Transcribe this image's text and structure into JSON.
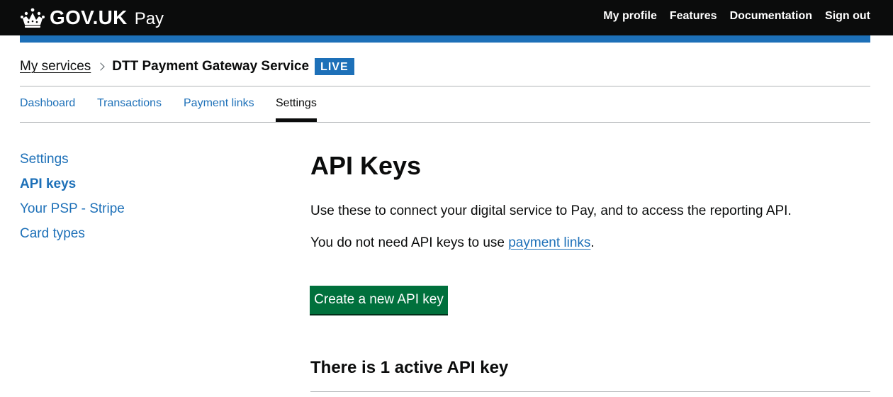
{
  "header": {
    "logo_text": "GOV.UK",
    "product": "Pay",
    "nav": [
      "My profile",
      "Features",
      "Documentation",
      "Sign out"
    ]
  },
  "breadcrumb": {
    "link": "My services",
    "current": "DTT Payment Gateway Service",
    "tag": "LIVE"
  },
  "tabs": {
    "items": [
      "Dashboard",
      "Transactions",
      "Payment links",
      "Settings"
    ],
    "active": "Settings"
  },
  "side_nav": {
    "items": [
      "Settings",
      "API keys",
      "Your PSP - Stripe",
      "Card types"
    ],
    "current": "API keys"
  },
  "main": {
    "title": "API Keys",
    "intro": "Use these to connect your digital service to Pay, and to access the reporting API.",
    "note_prefix": "You do not need API keys to use ",
    "note_link": "payment links",
    "note_suffix": ".",
    "button": "Create a new API key",
    "active_heading": "There is 1 active API key"
  },
  "colors": {
    "header": "#0b0c0c",
    "brand_blue": "#1d70b8",
    "button_green": "#00703c",
    "text": "#0b0c0c",
    "rule": "#b1b4b6"
  },
  "icons": [
    "crown-icon",
    "chevron-right-icon"
  ]
}
